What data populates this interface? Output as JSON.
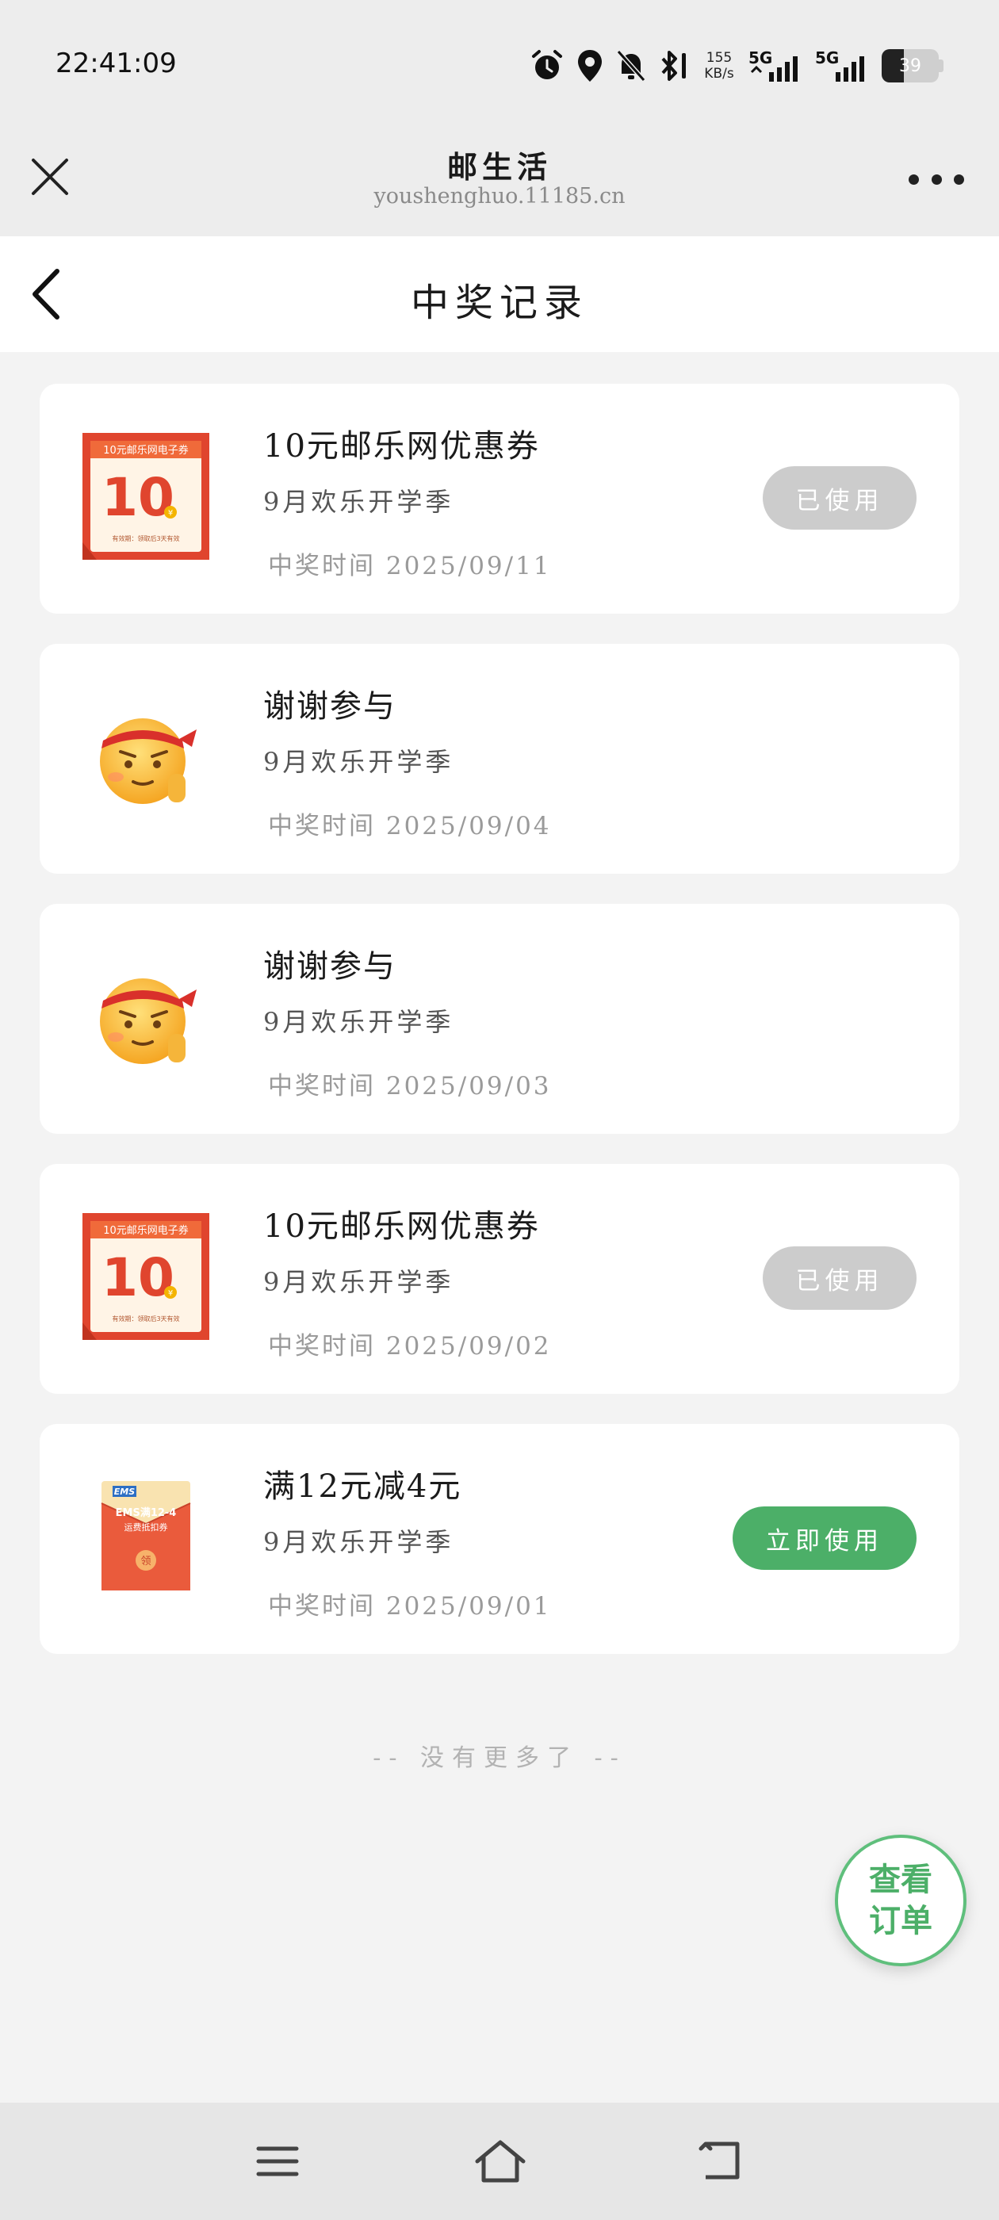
{
  "status_bar": {
    "time": "22:41:09",
    "net_speed_value": "155",
    "net_speed_unit": "KB/s",
    "signal1": "5G",
    "signal2": "5G",
    "battery": "39",
    "battery_fraction": 0.39
  },
  "title_bar": {
    "title": "邮生活",
    "url": "youshenghuo.11185.cn"
  },
  "page": {
    "title": "中奖记录"
  },
  "records": [
    {
      "name": "10元邮乐网优惠券",
      "activity": "9月欢乐开学季",
      "time": "中奖时间 2025/09/11",
      "action": "已使用",
      "thumb": "coupon-10-icon"
    },
    {
      "name": "谢谢参与",
      "activity": "9月欢乐开学季",
      "time": "中奖时间 2025/09/04",
      "action": "",
      "thumb": "thanks-emoji-icon"
    },
    {
      "name": "谢谢参与",
      "activity": "9月欢乐开学季",
      "time": "中奖时间 2025/09/03",
      "action": "",
      "thumb": "thanks-emoji-icon"
    },
    {
      "name": "10元邮乐网优惠券",
      "activity": "9月欢乐开学季",
      "time": "中奖时间 2025/09/02",
      "action": "已使用",
      "thumb": "coupon-10-icon"
    },
    {
      "name": "满12元减4元",
      "activity": "9月欢乐开学季",
      "time": "中奖时间 2025/09/01",
      "action": "立即使用",
      "thumb": "ems-envelope-icon"
    }
  ],
  "coupon_art": {
    "header": "10元邮乐网电子券",
    "amount": "10",
    "currency": "¥",
    "footer": "有效期：领取后3天有效"
  },
  "ems_art": {
    "brand": "EMS",
    "line1": "EMS满12-4",
    "line2": "运费抵扣券",
    "seal": "领"
  },
  "footer": {
    "no_more": "-- 没有更多了 --"
  },
  "fab": {
    "line1": "查看",
    "line2": "订单"
  },
  "colors": {
    "primary_green": "#4caf68",
    "used_gray": "#cccccc",
    "coupon_red": "#e0452e"
  }
}
